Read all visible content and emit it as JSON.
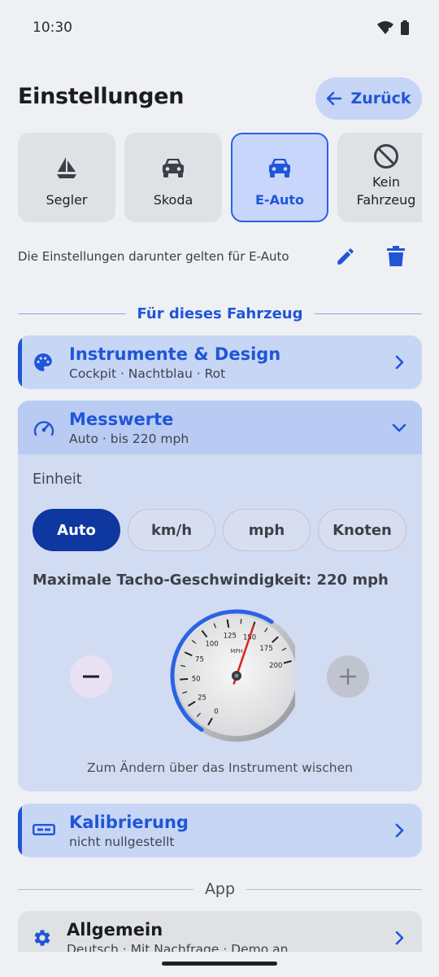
{
  "status_bar": {
    "time": "10:30",
    "icons": [
      "wifi-icon",
      "battery-icon"
    ]
  },
  "header": {
    "title": "Einstellungen",
    "back_label": "Zurück",
    "back_icon": "arrow-left-icon"
  },
  "vehicles": [
    {
      "label": "Segler",
      "icon": "sailboat-icon",
      "selected": false
    },
    {
      "label": "Skoda",
      "icon": "car-icon",
      "selected": false
    },
    {
      "label": "E-Auto",
      "icon": "car-icon",
      "selected": true
    },
    {
      "label": "Kein Fahrzeug",
      "icon": "block-icon",
      "selected": false
    }
  ],
  "vehicle_note": "Die Einstellungen darunter gelten für E-Auto",
  "vehicle_section_title": "Für dieses Fahrzeug",
  "sections": {
    "design": {
      "title": "Instrumente & Design",
      "subtitle": "Cockpit · Nachtblau · Rot",
      "icon": "palette-icon"
    },
    "measurements": {
      "title": "Messwerte",
      "subtitle": "Auto · bis 220 mph",
      "icon": "speedometer-icon",
      "expanded": true,
      "unit_label": "Einheit",
      "units": [
        {
          "label": "Auto",
          "selected": true
        },
        {
          "label": "km/h",
          "selected": false
        },
        {
          "label": "mph",
          "selected": false
        },
        {
          "label": "Knoten",
          "selected": false
        }
      ],
      "max_label": "Maximale Tacho-Geschwindigkeit: 220 mph",
      "gauge": {
        "unit": "MPH",
        "ticks": [
          "0",
          "25",
          "50",
          "75",
          "100",
          "125",
          "150",
          "175",
          "200"
        ],
        "needle_value": 150,
        "range_min": 0,
        "range_max": 220
      },
      "hint": "Zum Ändern über das Instrument wischen"
    },
    "calibration": {
      "title": "Kalibrierung",
      "subtitle": "nicht nullgestellt",
      "icon": "ruler-icon"
    }
  },
  "app_section_title": "App",
  "general": {
    "title": "Allgemein",
    "subtitle": "Deutsch · Mit Nachfrage · Demo an",
    "icon": "gear-icon"
  },
  "colors": {
    "accent": "#1f56d8",
    "selected_unit": "#0f37a0",
    "card_bg": "#c8d6f6",
    "gauge_ring": "#2a62e6",
    "needle": "#d62828"
  }
}
